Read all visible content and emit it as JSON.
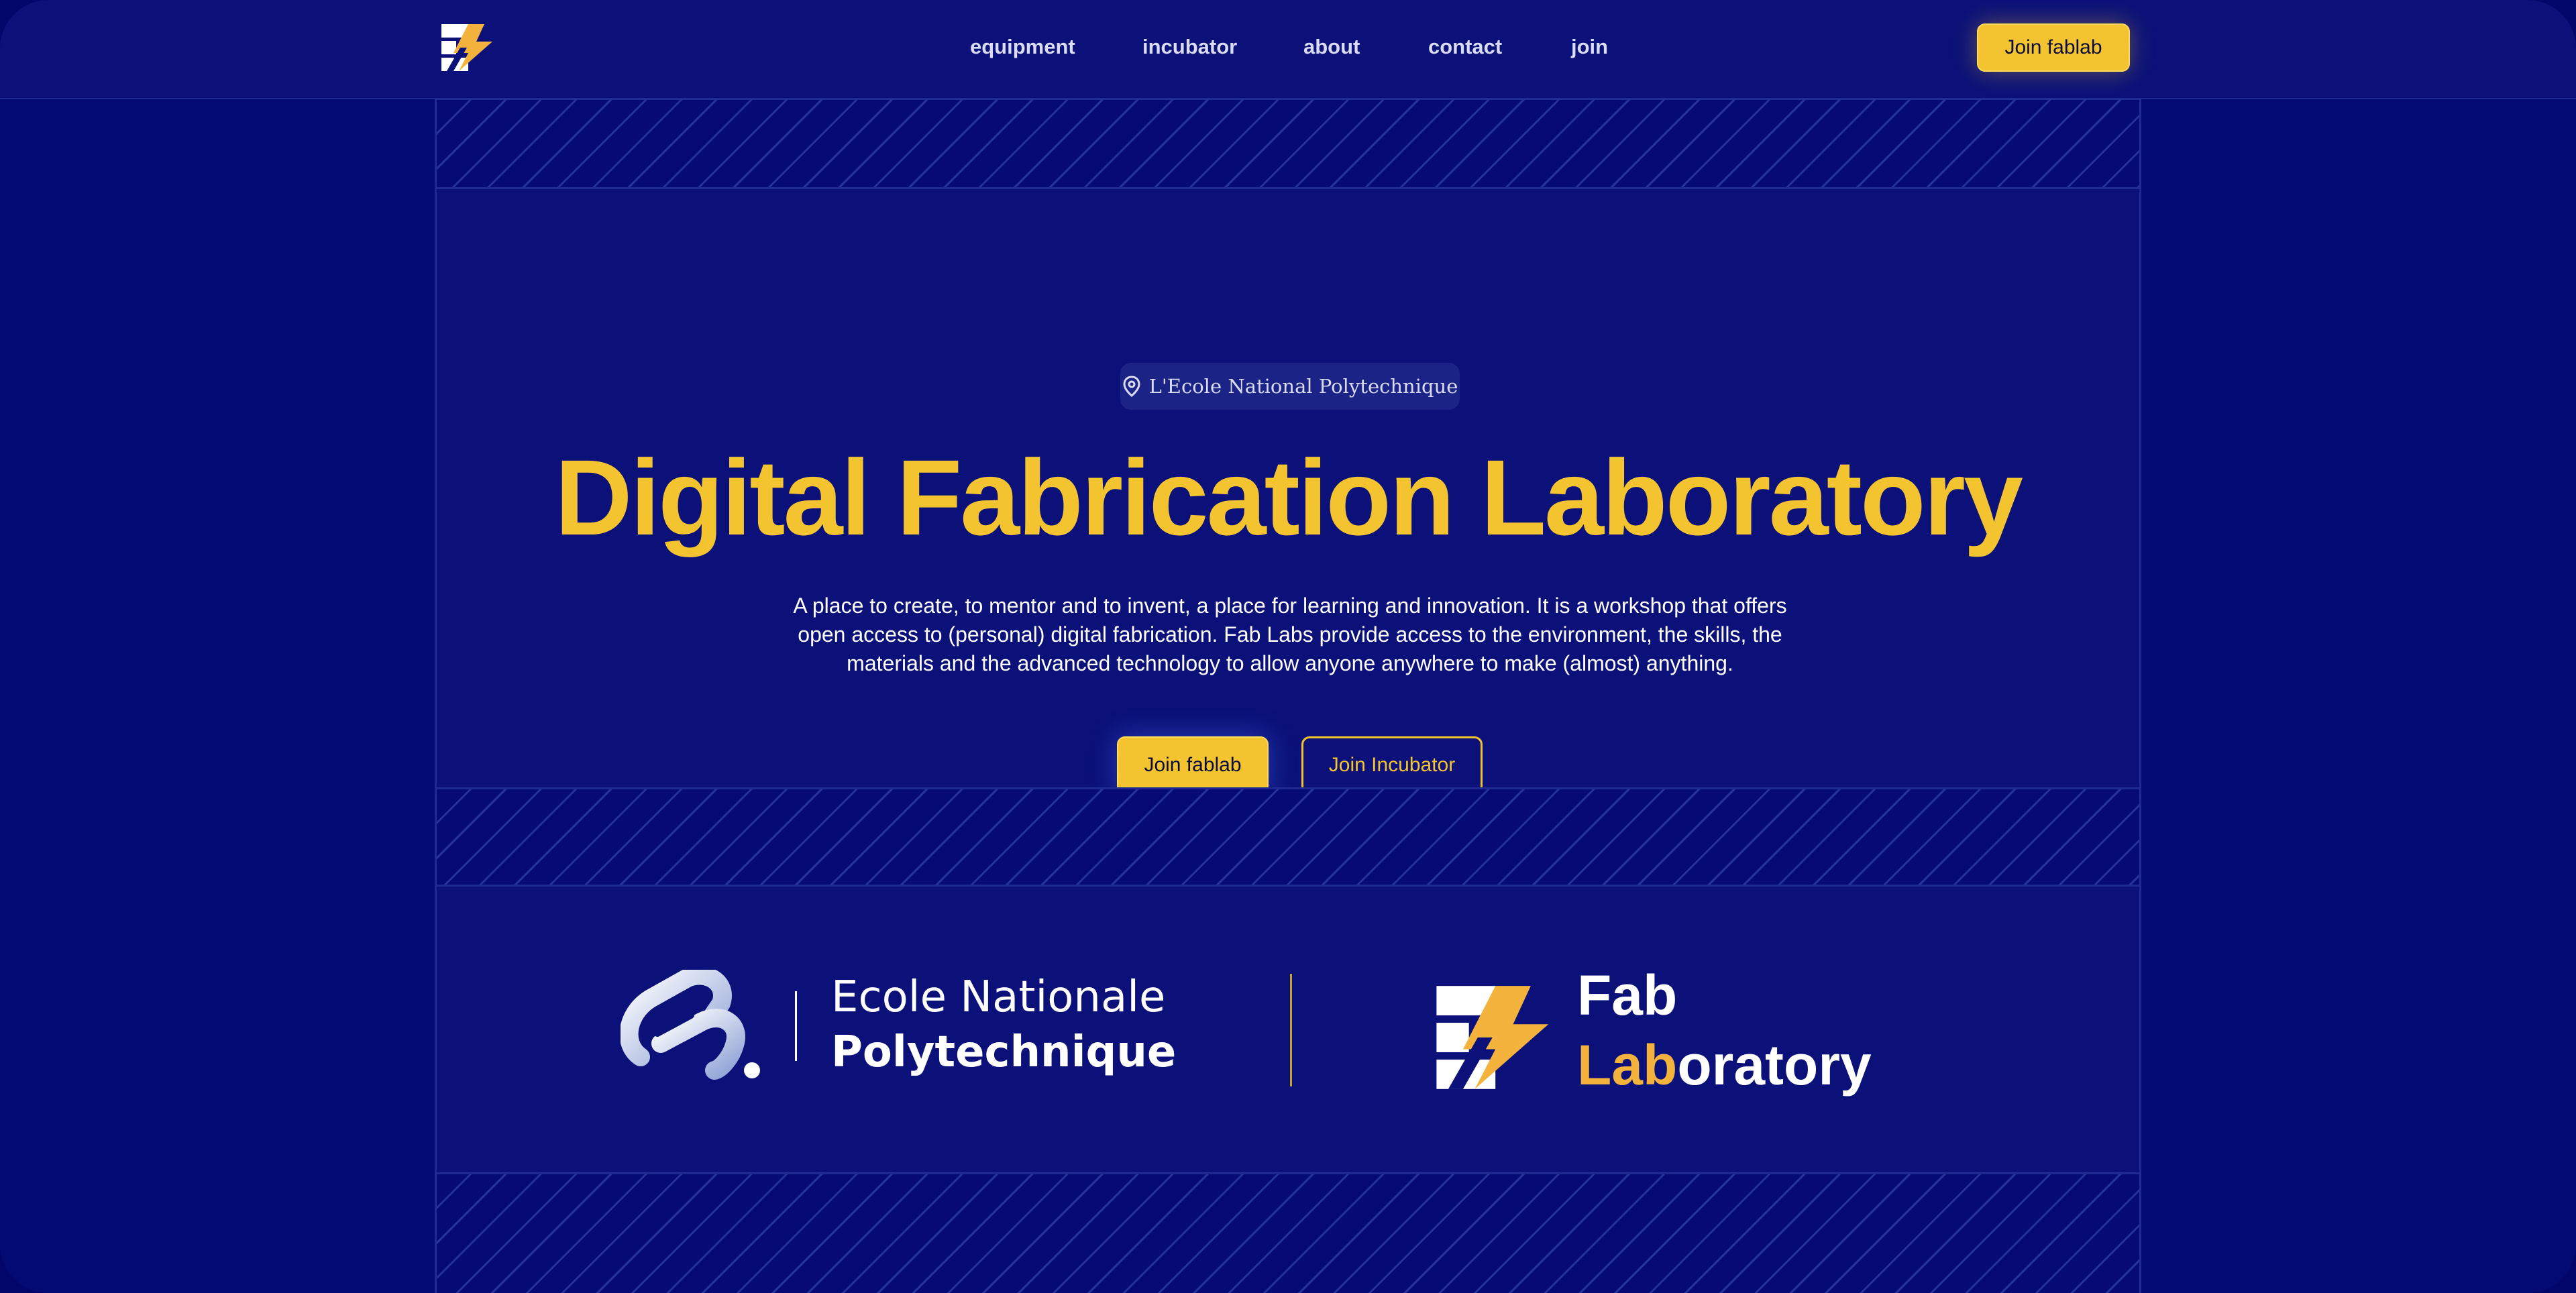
{
  "nav": {
    "items": [
      "equipment",
      "incubator",
      "about",
      "contact",
      "join"
    ],
    "cta_label": "Join fablab"
  },
  "hero": {
    "location": "L'Ecole National Polytechnique",
    "title": "Digital Fabrication Laboratory",
    "description_lines": [
      "A place to create, to mentor and to invent, a place for learning and innovation. It is a workshop that offers",
      "open access to (personal) digital fabrication. Fab Labs provide access to the environment, the skills, the",
      "materials and the advanced technology to allow anyone anywhere to make (almost) anything."
    ],
    "primary_button": "Join fablab",
    "secondary_button": "Join Incubator"
  },
  "partners": {
    "ecole_line1": "Ecole Nationale",
    "ecole_line2": "Polytechnique",
    "fab_line1": "Fab",
    "fab_line2_highlight": "Lab",
    "fab_line2_rest": "oratory"
  },
  "colors": {
    "background": "#040a73",
    "accent": "#f4c430",
    "panel": "#0b1178",
    "logo_orange": "#f4b33c"
  },
  "icons": [
    "fablab-logo-icon",
    "location-pin-icon",
    "ecole-logo-icon"
  ]
}
